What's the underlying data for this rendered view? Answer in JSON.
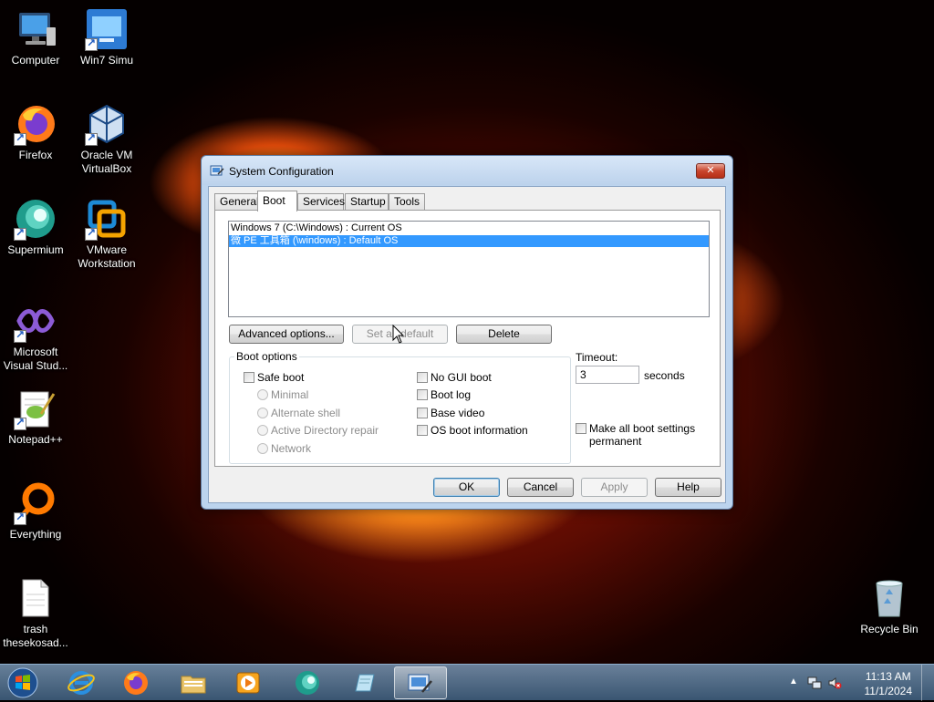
{
  "desktop": {
    "icons": [
      {
        "label": "Computer",
        "icon": "computer-icon"
      },
      {
        "label": "Win7 Simu",
        "icon": "win7-simu-icon"
      },
      {
        "label": "Firefox",
        "icon": "firefox-icon"
      },
      {
        "label": "Oracle VM VirtualBox",
        "icon": "virtualbox-icon"
      },
      {
        "label": "Supermium",
        "icon": "supermium-icon"
      },
      {
        "label": "VMware Workstation",
        "icon": "vmware-icon"
      },
      {
        "label": "Microsoft Visual Stud...",
        "icon": "visual-studio-icon"
      },
      {
        "label": "Notepad++",
        "icon": "notepadpp-icon"
      },
      {
        "label": "Everything",
        "icon": "everything-icon"
      },
      {
        "label": "trash thesekosad...",
        "icon": "text-file-icon"
      },
      {
        "label": "Recycle Bin",
        "icon": "recycle-bin-icon"
      }
    ]
  },
  "dialog": {
    "title": "System Configuration",
    "close_label": "✕",
    "tabs": [
      {
        "label": "General"
      },
      {
        "label": "Boot"
      },
      {
        "label": "Services"
      },
      {
        "label": "Startup"
      },
      {
        "label": "Tools"
      }
    ],
    "active_tab": "Boot",
    "os_list": [
      {
        "text": "Windows 7 (C:\\Windows) : Current OS",
        "selected": false
      },
      {
        "text": "微 PE 工具箱 (\\windows) : Default OS",
        "selected": true
      }
    ],
    "buttons": {
      "advanced": "Advanced options...",
      "set_default": "Set as default",
      "delete": "Delete"
    },
    "boot_options": {
      "title": "Boot options",
      "safe_boot": "Safe boot",
      "minimal": "Minimal",
      "alternate_shell": "Alternate shell",
      "ad_repair": "Active Directory repair",
      "network": "Network",
      "no_gui": "No GUI boot",
      "boot_log": "Boot log",
      "base_video": "Base video",
      "os_boot_info": "OS boot information"
    },
    "timeout": {
      "label": "Timeout:",
      "value": "3",
      "unit": "seconds"
    },
    "make_permanent": "Make all boot settings permanent",
    "footer": {
      "ok": "OK",
      "cancel": "Cancel",
      "apply": "Apply",
      "help": "Help"
    }
  },
  "taskbar": {
    "clock_time": "11:13 AM",
    "clock_date": "11/1/2024",
    "items": [
      "internet-explorer-icon",
      "firefox-icon",
      "file-explorer-icon",
      "media-player-icon",
      "supermium-icon",
      "notepad-icon",
      "system-configuration-icon"
    ]
  }
}
